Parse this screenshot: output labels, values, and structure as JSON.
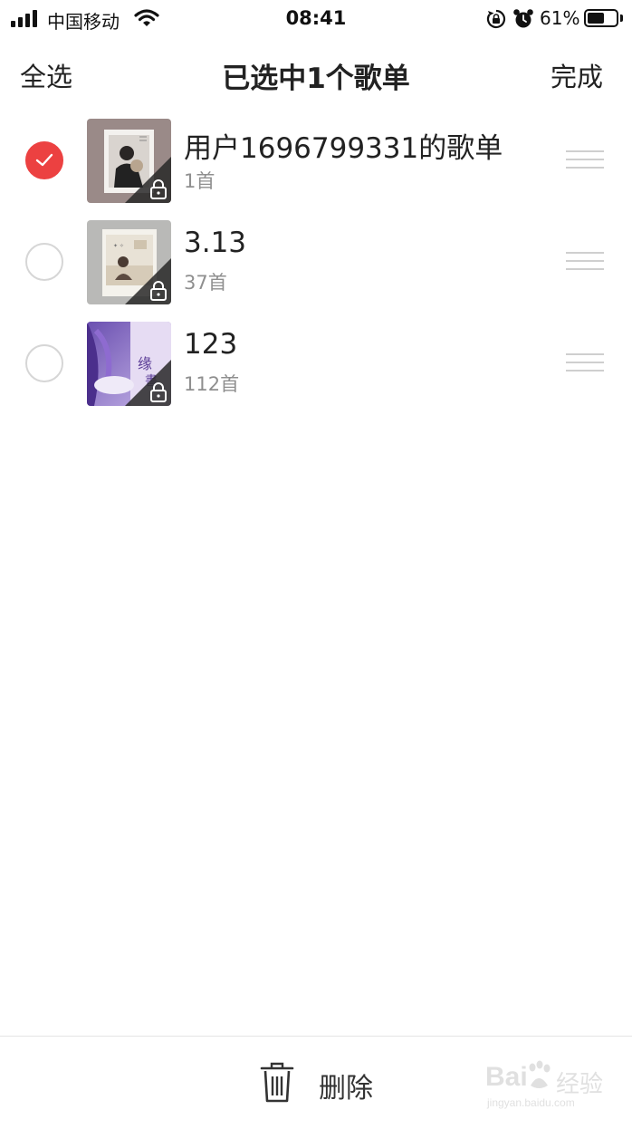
{
  "status_bar": {
    "carrier": "中国移动",
    "time": "08:41",
    "battery": "61%",
    "battery_level": 0.61
  },
  "header": {
    "select_all": "全选",
    "title": "已选中1个歌单",
    "done": "完成"
  },
  "playlists": [
    {
      "title": "用户1696799331的歌单",
      "count": "1首",
      "selected": true
    },
    {
      "title": "3.13",
      "count": "37首",
      "selected": false
    },
    {
      "title": "123",
      "count": "112首",
      "selected": false
    }
  ],
  "bottom_bar": {
    "delete_label": "删除"
  },
  "watermark": {
    "logo": "Bai",
    "brand": "经验",
    "url": "jingyan.baidu.com"
  },
  "colors": {
    "accent": "#ec4141",
    "text": "#222222",
    "muted": "#8f8f8f"
  }
}
